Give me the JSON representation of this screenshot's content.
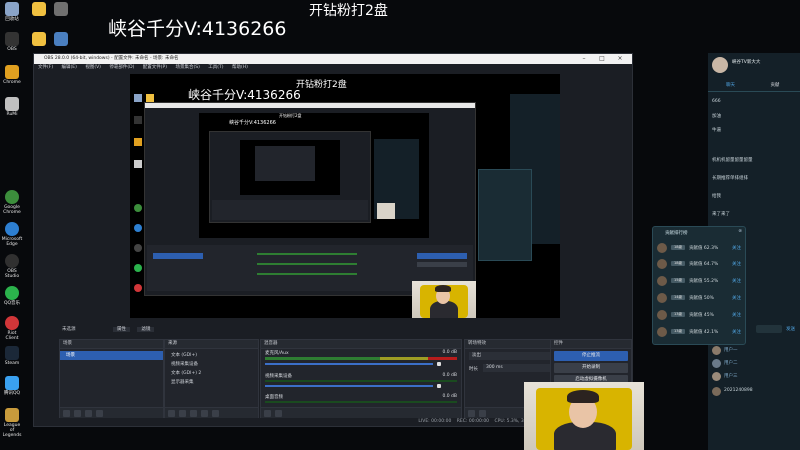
{
  "overlay": {
    "title_left": "峡谷千分V:4136266",
    "title_right": "开钻粉打2盘"
  },
  "desktop_icons": [
    {
      "label": "回收站",
      "color": "#8aa4c8"
    },
    {
      "label": "OBS",
      "color": "#202020"
    },
    {
      "label": "Chrome",
      "color": "#e0a020"
    },
    {
      "label": "RuMi",
      "color": "#c0c0c0"
    },
    {
      "label": "Google Chrome",
      "color": "#3c8e3c"
    },
    {
      "label": "Microsoft Edge",
      "color": "#2d7fd1"
    },
    {
      "label": "OBS Studio",
      "color": "#303030"
    },
    {
      "label": "QQ音乐",
      "color": "#2bb24c"
    },
    {
      "label": "Riot Client",
      "color": "#d13639"
    },
    {
      "label": "Steam",
      "color": "#1b2838"
    },
    {
      "label": "腾讯QQ",
      "color": "#3aa1f0"
    },
    {
      "label": "League of Legends",
      "color": "#c89b3c"
    }
  ],
  "obs": {
    "window_title": "OBS 28.0.0 (64-bit, windows) - 配置文件: 未命名 - 场景: 未命名",
    "menu": [
      "文件(F)",
      "编辑(E)",
      "视图(V)",
      "停靠部件(D)",
      "配置文件(P)",
      "场景集合(S)",
      "工具(T)",
      "帮助(H)"
    ],
    "source_toolbar": {
      "source_label": "未选源",
      "props_label": "属性",
      "filters_label": "滤镜"
    },
    "scenes": {
      "header": "场景",
      "items": [
        "场景"
      ]
    },
    "sources": {
      "header": "来源",
      "items": [
        "文本 (GDI+)",
        "视频采集设备",
        "文本 (GDI+) 2",
        "显示器采集"
      ]
    },
    "mixer": {
      "header": "混音器",
      "channels": [
        {
          "name": "麦克风/Aux",
          "db": "0.0 dB"
        },
        {
          "name": "视频采集设备",
          "db": "0.0 dB"
        },
        {
          "name": "桌面音频",
          "db": "0.0 dB"
        }
      ]
    },
    "transitions": {
      "header": "转场特效",
      "type": "淡出",
      "duration_label": "时长",
      "duration": "300 ms"
    },
    "controls": {
      "header": "控件",
      "buttons": [
        "停止推流",
        "开始录制",
        "启动虚拟摄像机",
        "工作室模式",
        "设置",
        "退出"
      ]
    },
    "status": {
      "live": "LIVE: 00:00:00",
      "rec": "REC: 00:00:00",
      "cpu": "CPU: 5.3%, 30.00 fps"
    }
  },
  "chat": {
    "header_name": "峡谷TV新大大",
    "tabs": [
      "聊天",
      "贡献"
    ],
    "messages": [
      {
        "user": "用户",
        "text": "666"
      },
      {
        "user": "用户",
        "text": "加油"
      },
      {
        "user": "用户",
        "text": "牛逼"
      },
      {
        "user": "用户",
        "text": "机机机留量留量留量"
      },
      {
        "user": "用户",
        "text": "长期推荐单排组排"
      },
      {
        "user": "用户",
        "text": "给我"
      },
      {
        "user": "用户",
        "text": "来了来了"
      }
    ],
    "send_label": "发送",
    "viewers": [
      {
        "name": "用户一",
        "level": "15"
      },
      {
        "name": "用户二",
        "level": "12"
      },
      {
        "name": "用户三",
        "level": "20"
      },
      {
        "name": "2021240898",
        "level": "9"
      }
    ]
  },
  "rank_panel": {
    "title": "贡献排行榜",
    "rows": [
      {
        "lv": "18级",
        "text": "贡献值 62.3%",
        "btn": "关注"
      },
      {
        "lv": "18级",
        "text": "贡献值 64.7%",
        "btn": "关注"
      },
      {
        "lv": "15级",
        "text": "贡献值 55.2%",
        "btn": "关注"
      },
      {
        "lv": "14级",
        "text": "贡献值 50%",
        "btn": "关注"
      },
      {
        "lv": "13级",
        "text": "贡献值 45%",
        "btn": "关注"
      },
      {
        "lv": "13级",
        "text": "贡献值 42.1%",
        "btn": "关注"
      }
    ]
  },
  "nested": {
    "title_left": "峡谷千分V:4136266",
    "title_right": "开钻粉打2盘"
  }
}
